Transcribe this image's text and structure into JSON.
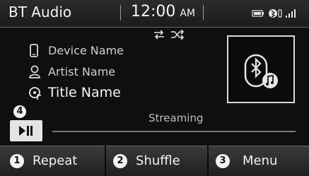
{
  "status_bar": {
    "app_title": "BT Audio",
    "time": "12:00",
    "ampm": "AM",
    "icons": [
      "battery-icon",
      "bluetooth-phone-icon",
      "signal-strength-icon"
    ]
  },
  "controls": {
    "repeat_icon": "repeat-icon",
    "shuffle_icon": "shuffle-icon"
  },
  "track": {
    "device_name": "Device Name",
    "artist_name": "Artist Name",
    "title_name": "Title Name",
    "device_icon": "phone-icon",
    "artist_icon": "person-icon",
    "title_icon": "music-disc-icon"
  },
  "album_art": {
    "icon": "bluetooth-music-icon"
  },
  "player": {
    "step_number": "4",
    "play_pause_icon": "play-pause-icon",
    "streaming_label": "Streaming"
  },
  "bottom_buttons": [
    {
      "number": "1",
      "label": "Repeat"
    },
    {
      "number": "2",
      "label": "Shuffle"
    },
    {
      "number": "3",
      "label": "Menu"
    }
  ]
}
